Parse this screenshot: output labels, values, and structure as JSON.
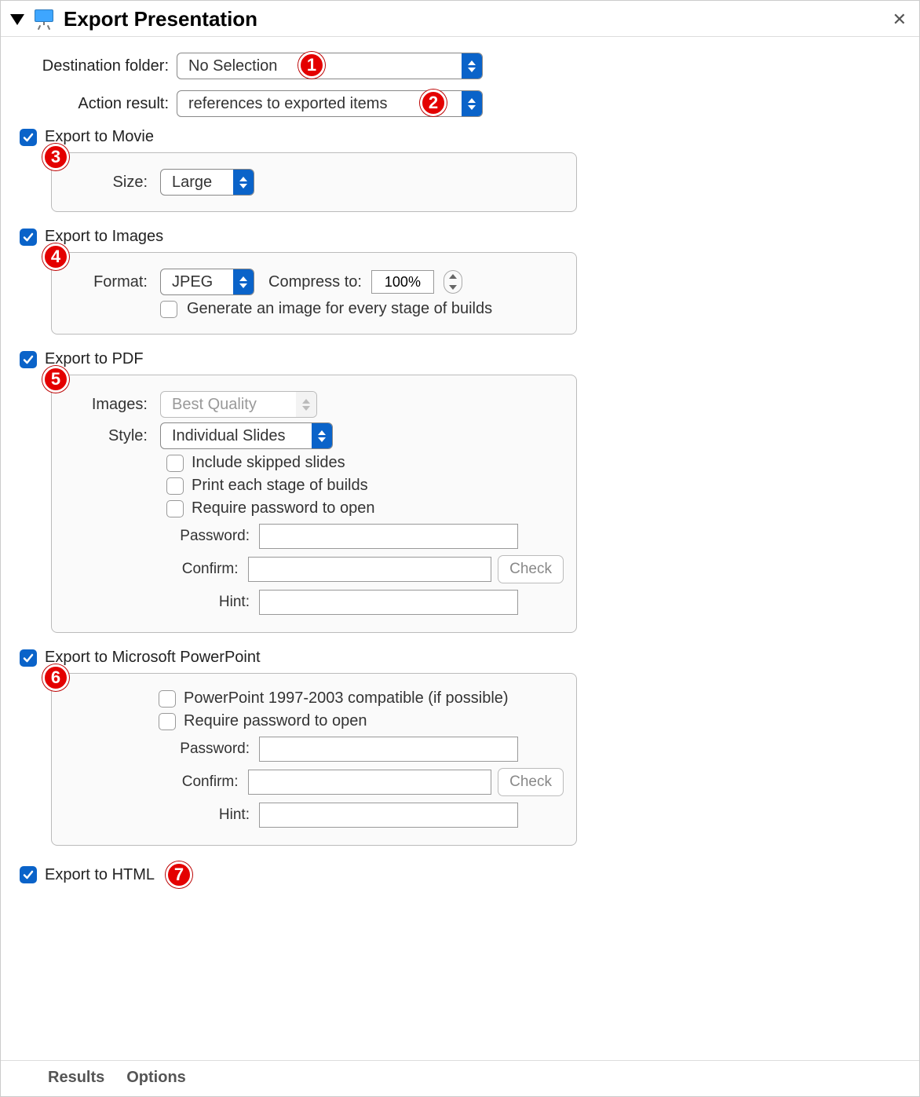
{
  "header": {
    "title": "Export Presentation"
  },
  "top": {
    "destination_label": "Destination folder:",
    "destination_value": "No Selection",
    "result_label": "Action result:",
    "result_value": "references to exported items"
  },
  "movie": {
    "section": "Export to Movie",
    "size_label": "Size:",
    "size_value": "Large"
  },
  "images": {
    "section": "Export to Images",
    "format_label": "Format:",
    "format_value": "JPEG",
    "compress_label": "Compress to:",
    "compress_value": "100%",
    "builds_label": "Generate an image for every stage of builds"
  },
  "pdf": {
    "section": "Export to PDF",
    "images_label": "Images:",
    "images_value": "Best Quality",
    "style_label": "Style:",
    "style_value": "Individual Slides",
    "opt_skipped": "Include skipped slides",
    "opt_stages": "Print each stage of builds",
    "opt_require": "Require password to open",
    "password_label": "Password:",
    "confirm_label": "Confirm:",
    "hint_label": "Hint:",
    "check_btn": "Check"
  },
  "ppt": {
    "section": "Export to Microsoft PowerPoint",
    "opt_compat": "PowerPoint 1997-2003 compatible (if possible)",
    "opt_require": "Require password to open",
    "password_label": "Password:",
    "confirm_label": "Confirm:",
    "hint_label": "Hint:",
    "check_btn": "Check"
  },
  "html": {
    "section": "Export to HTML"
  },
  "footer": {
    "results": "Results",
    "options": "Options"
  },
  "callouts": [
    "1",
    "2",
    "3",
    "4",
    "5",
    "6",
    "7"
  ]
}
